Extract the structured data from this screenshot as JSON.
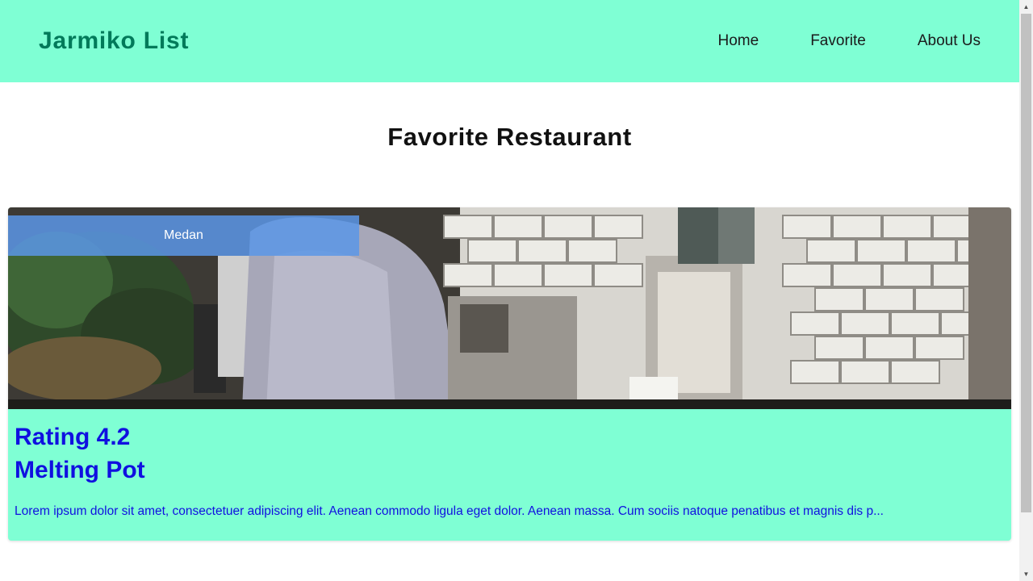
{
  "header": {
    "brand": "Jarmiko List",
    "nav": [
      "Home",
      "Favorite",
      "About Us"
    ]
  },
  "main": {
    "title": "Favorite Restaurant",
    "restaurants": [
      {
        "city": "Medan",
        "rating": "Rating 4.2",
        "name": "Melting Pot",
        "description": "Lorem ipsum dolor sit amet, consectetuer adipiscing elit. Aenean commodo ligula eget dolor. Aenean massa. Cum sociis natoque penatibus et magnis dis p..."
      }
    ]
  },
  "colors": {
    "accent": "#7fffd4",
    "brand_text": "#017a5a",
    "card_text": "#1010e0",
    "badge": "#5a96e6"
  }
}
